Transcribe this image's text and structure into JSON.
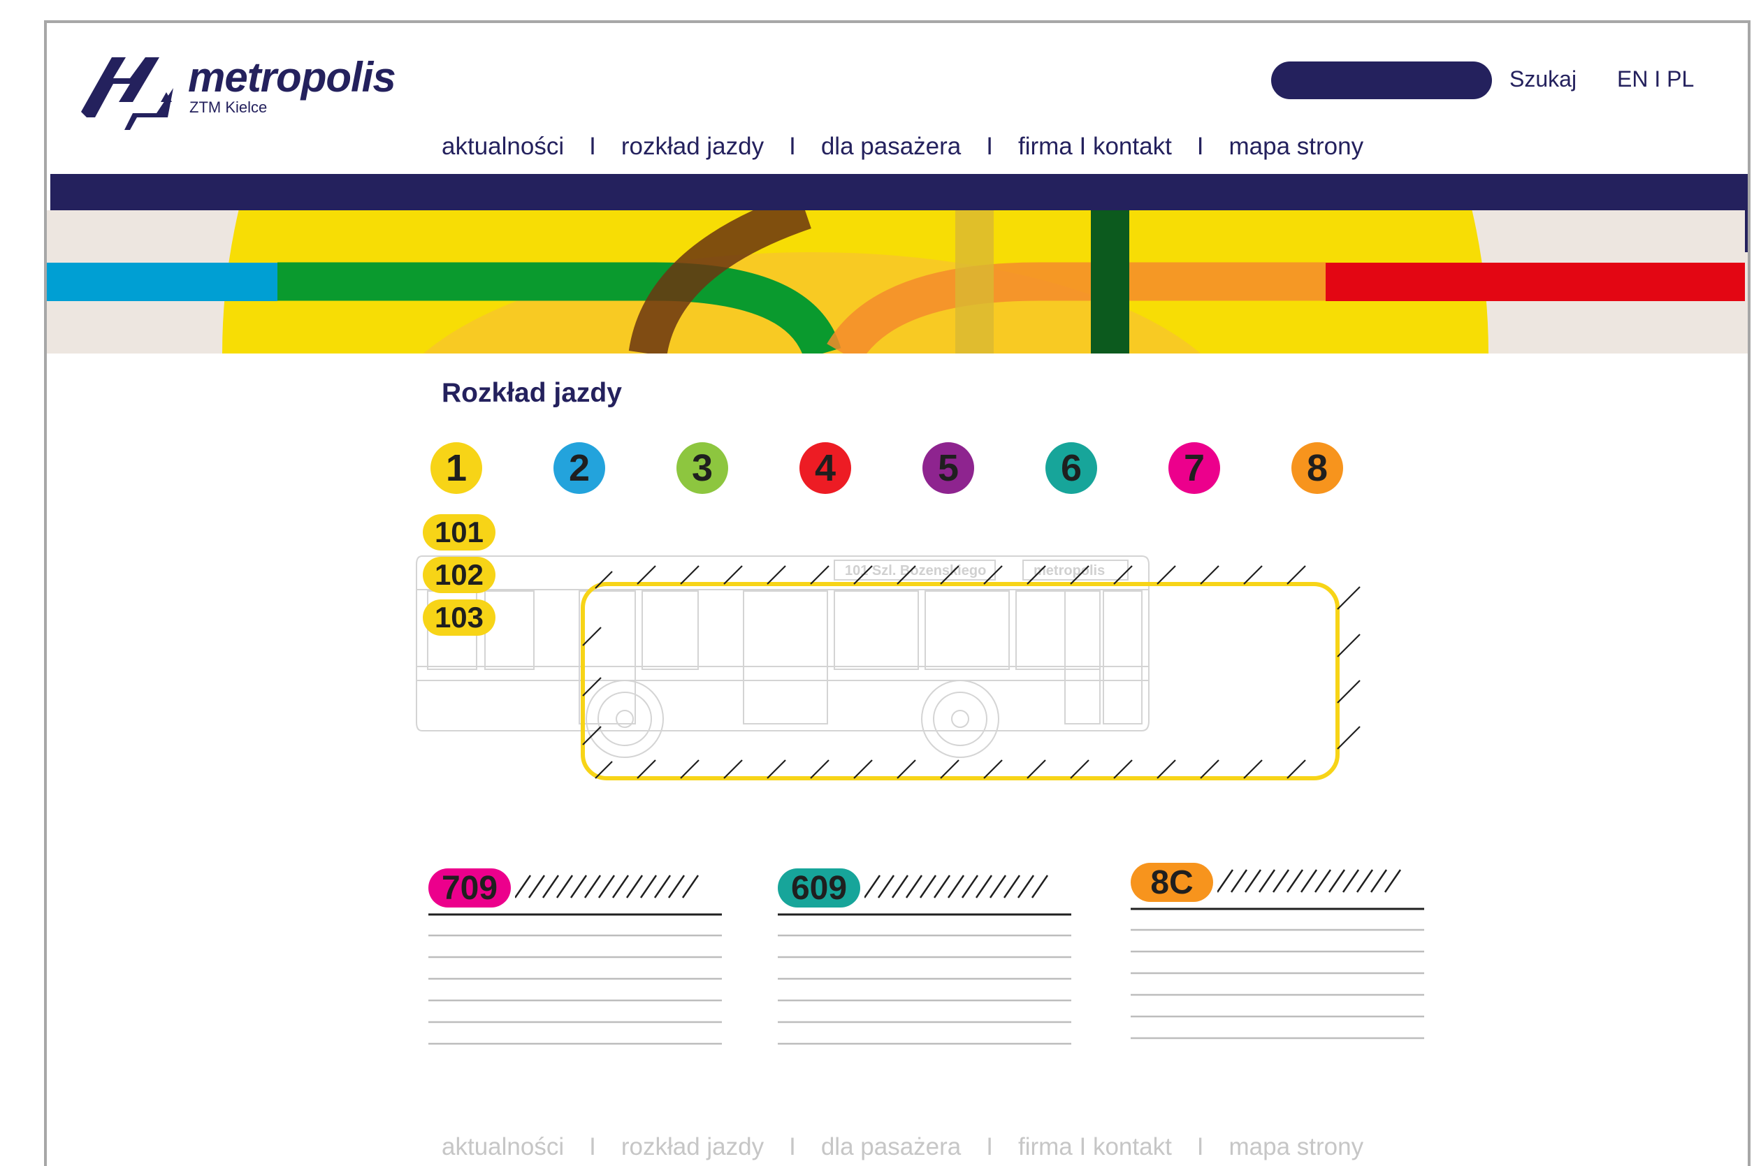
{
  "brand": {
    "name": "metropolis",
    "subtitle": "ZTM Kielce",
    "color": "#24215d"
  },
  "search": {
    "label": "Szukaj",
    "value": "",
    "placeholder": ""
  },
  "language": {
    "en": "EN",
    "separator": " I ",
    "pl": "PL"
  },
  "nav": {
    "items": [
      "aktualności",
      "rozkład jazdy",
      "dla pasażera",
      "firma I kontakt",
      "mapa strony"
    ],
    "separator": "I"
  },
  "page": {
    "title": "Rozkład jazdy"
  },
  "lines": [
    {
      "label": "1",
      "color": "#f7d417"
    },
    {
      "label": "2",
      "color": "#23a3dc"
    },
    {
      "label": "3",
      "color": "#8dc63f"
    },
    {
      "label": "4",
      "color": "#ed1c24"
    },
    {
      "label": "5",
      "color": "#8e248f"
    },
    {
      "label": "6",
      "color": "#17a59a"
    },
    {
      "label": "7",
      "color": "#ec008c"
    },
    {
      "label": "8",
      "color": "#f7941d"
    }
  ],
  "sub_lines": [
    "101",
    "102",
    "103"
  ],
  "bus_illustration": {
    "destination_sign": "101 Szl. Bozenskiego",
    "brand_sign": "metropolis"
  },
  "routes": [
    {
      "label": "709",
      "color": "#ec008c"
    },
    {
      "label": "609",
      "color": "#17a59a"
    },
    {
      "label": "8C",
      "color": "#f7941d"
    }
  ],
  "colors": {
    "accent": "#24215d",
    "banner_bg": "#ede6e0",
    "highlight": "#f7d417"
  }
}
